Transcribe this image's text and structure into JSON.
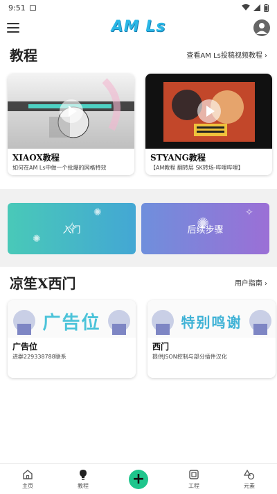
{
  "status": {
    "time": "9:51"
  },
  "header": {
    "logo": "AM Ls"
  },
  "tutorials": {
    "title": "教程",
    "link": "查看AM Ls投稿视频教程 ›",
    "cards": [
      {
        "title": "XIAOX教程",
        "desc": "如何在AM Ls中做一个批爆的网格特效"
      },
      {
        "title": "STYANG教程",
        "desc": "【AM教程 翻转层 SK转场-哔哩哔哩】"
      }
    ]
  },
  "actions": {
    "start": "入门",
    "next": "后续步骤"
  },
  "community": {
    "title": "凉笙X西门",
    "link": "用户指南 ›",
    "cards": [
      {
        "banner": "广告位",
        "title": "广告位",
        "desc": "进群229338788联系"
      },
      {
        "banner": "特别鸣谢",
        "title": "西门",
        "desc": "提供JSON控制与部分插件汉化"
      }
    ]
  },
  "nav": {
    "home": "主页",
    "tutorial": "教程",
    "add": "+",
    "project": "工程",
    "elements": "元素"
  }
}
